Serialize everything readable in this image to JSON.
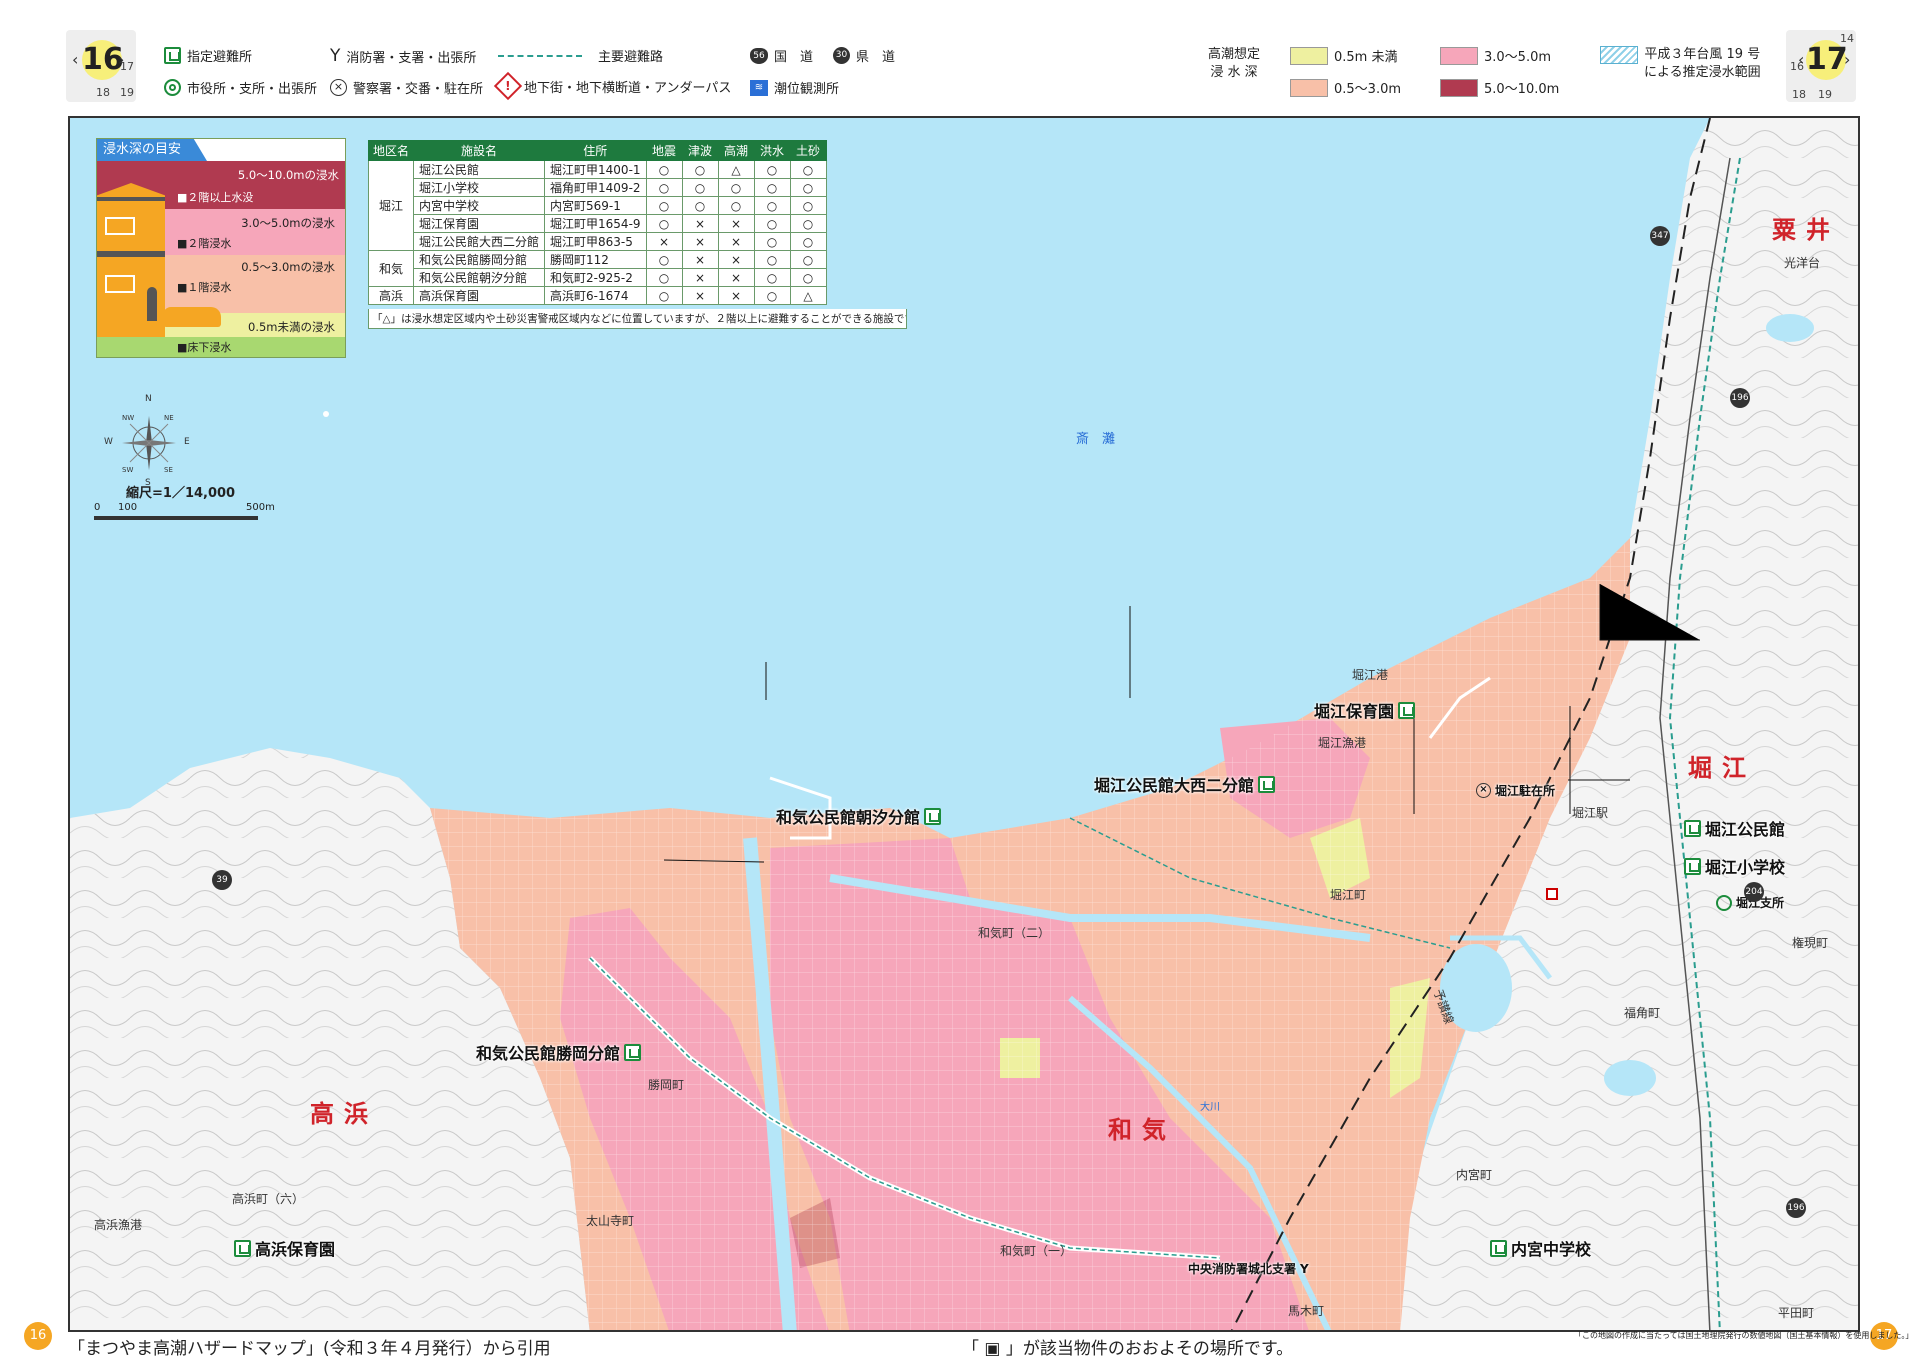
{
  "header": {
    "left_page": {
      "big": "16",
      "tr": "17",
      "bl": "18",
      "br": "19"
    },
    "right_page": {
      "big": "17",
      "tr": "14",
      "l": "16",
      "bl": "18",
      "br": "19"
    },
    "legend": {
      "shelter": "指定避難所",
      "fire": "消防署・支署・出張所",
      "main_route": "主要避難路",
      "national": "国　道",
      "prefectural": "県　道",
      "office": "市役所・支所・出張所",
      "police": "警察署・交番・駐在所",
      "underpass": "地下街・地下横断道・アンダーパス",
      "tide": "潮位観測所",
      "national_num": "56",
      "pref_num": "30"
    },
    "depth_legend": {
      "title_1": "高潮想定",
      "title_2": "浸 水 深",
      "items": [
        {
          "label": "0.5m 未満",
          "color": "#eef0a0"
        },
        {
          "label": "3.0～5.0m",
          "color": "#f6a6ba"
        },
        {
          "label": "0.5～3.0m",
          "color": "#f8c0a8"
        },
        {
          "label": "5.0～10.0m",
          "color": "#b03a50"
        }
      ],
      "typhoon_1": "平成３年台風 19 号",
      "typhoon_2": "による推定浸水範囲"
    }
  },
  "guide": {
    "title": "浸水深の目安",
    "rows": [
      {
        "range": "5.0～10.0mの浸水",
        "desc": "■２階以上水没",
        "color": "#b03a50"
      },
      {
        "range": "3.0～5.0mの浸水",
        "desc": "■２階浸水",
        "color": "#f6a6ba"
      },
      {
        "range": "0.5～3.0mの浸水",
        "desc": "■１階浸水",
        "color": "#f8c0a8"
      },
      {
        "range": "0.5m未満の浸水",
        "desc": "■床下浸水",
        "color": "#eef0a0"
      }
    ]
  },
  "table": {
    "headers": [
      "地区名",
      "施設名",
      "住所",
      "地震",
      "津波",
      "高潮",
      "洪水",
      "土砂"
    ],
    "rows": [
      {
        "district": "堀江",
        "rowspan": 5,
        "name": "堀江公民館",
        "addr": "堀江町甲1400-1",
        "marks": [
          "○",
          "○",
          "△",
          "○",
          "○"
        ]
      },
      {
        "name": "堀江小学校",
        "addr": "福角町甲1409-2",
        "marks": [
          "○",
          "○",
          "○",
          "○",
          "○"
        ]
      },
      {
        "name": "内宮中学校",
        "addr": "内宮町569-1",
        "marks": [
          "○",
          "○",
          "○",
          "○",
          "○"
        ]
      },
      {
        "name": "堀江保育園",
        "addr": "堀江町甲1654-9",
        "marks": [
          "○",
          "×",
          "×",
          "○",
          "○"
        ]
      },
      {
        "name": "堀江公民館大西二分館",
        "addr": "堀江町甲863-5",
        "marks": [
          "×",
          "×",
          "×",
          "○",
          "○"
        ]
      },
      {
        "district": "和気",
        "rowspan": 2,
        "name": "和気公民館勝岡分館",
        "addr": "勝岡町112",
        "marks": [
          "○",
          "×",
          "×",
          "○",
          "○"
        ]
      },
      {
        "name": "和気公民館朝汐分館",
        "addr": "和気町2-925-2",
        "marks": [
          "○",
          "×",
          "×",
          "○",
          "○"
        ]
      },
      {
        "district": "高浜",
        "rowspan": 1,
        "name": "高浜保育園",
        "addr": "高浜町6-1674",
        "marks": [
          "○",
          "×",
          "×",
          "○",
          "△"
        ]
      }
    ],
    "note": "「△」は浸水想定区域内や土砂災害警戒区域内などに位置していますが、２階以上に避難することができる施設です。"
  },
  "compass": {
    "n": "N",
    "s": "S",
    "e": "E",
    "w": "W",
    "ne": "NE",
    "nw": "NW",
    "se": "SE",
    "sw": "SW"
  },
  "scale": {
    "label": "縮尺=1／14,000",
    "t0": "0",
    "t1": "100",
    "t2": "500m"
  },
  "map": {
    "sea": "斎　灘",
    "areas": {
      "takahama": "高浜",
      "wake": "和気",
      "horie": "堀江",
      "awai": "粟井"
    },
    "facilities": {
      "horie_kominkan": "堀江公民館",
      "horie_shogakko": "堀江小学校",
      "horie_shisho": "堀江支所",
      "horie_hoikuen": "堀江保育園",
      "onishi": "堀江公民館大西二分館",
      "asashio": "和気公民館朝汐分館",
      "katsuoka": "和気公民館勝岡分館",
      "takahama_hoikuen": "高浜保育園",
      "uchimiya": "内宮中学校",
      "shobo": "中央消防署城北支署",
      "chuzaisho": "堀江駐在所"
    },
    "places": {
      "horie_ko": "堀江港",
      "horie_gyoko": "堀江漁港",
      "horie_eki": "堀江駅",
      "horie_cho": "堀江町",
      "gongen": "権現町",
      "fukusumi": "福角町",
      "wake_ni": "和気町（二）",
      "wake_ichi": "和気町（一）",
      "katsuoka_cho": "勝岡町",
      "takahama_roku": "高浜町（六）",
      "takahama_gyoko": "高浜漁港",
      "taisanji": "太山寺町",
      "uchimiya_cho": "内宮町",
      "umaki": "馬木町",
      "hirata": "平田町",
      "kokodai": "光洋台",
      "yosan": "予讃線",
      "ookawa": "大川"
    },
    "routes": [
      "347",
      "196",
      "39",
      "204",
      "196"
    ]
  },
  "footer": {
    "left_num": "16",
    "right_num": "17",
    "source": "「まつやま高潮ハザードマップ」(令和３年４月発行）から引用",
    "marker_note": "「 ▣ 」が該当物件のおおよその場所です。",
    "fine_print": "「この地図の作成に当たっては国土地理院発行の数値地図（国土基本情報）を使用しました。」"
  }
}
